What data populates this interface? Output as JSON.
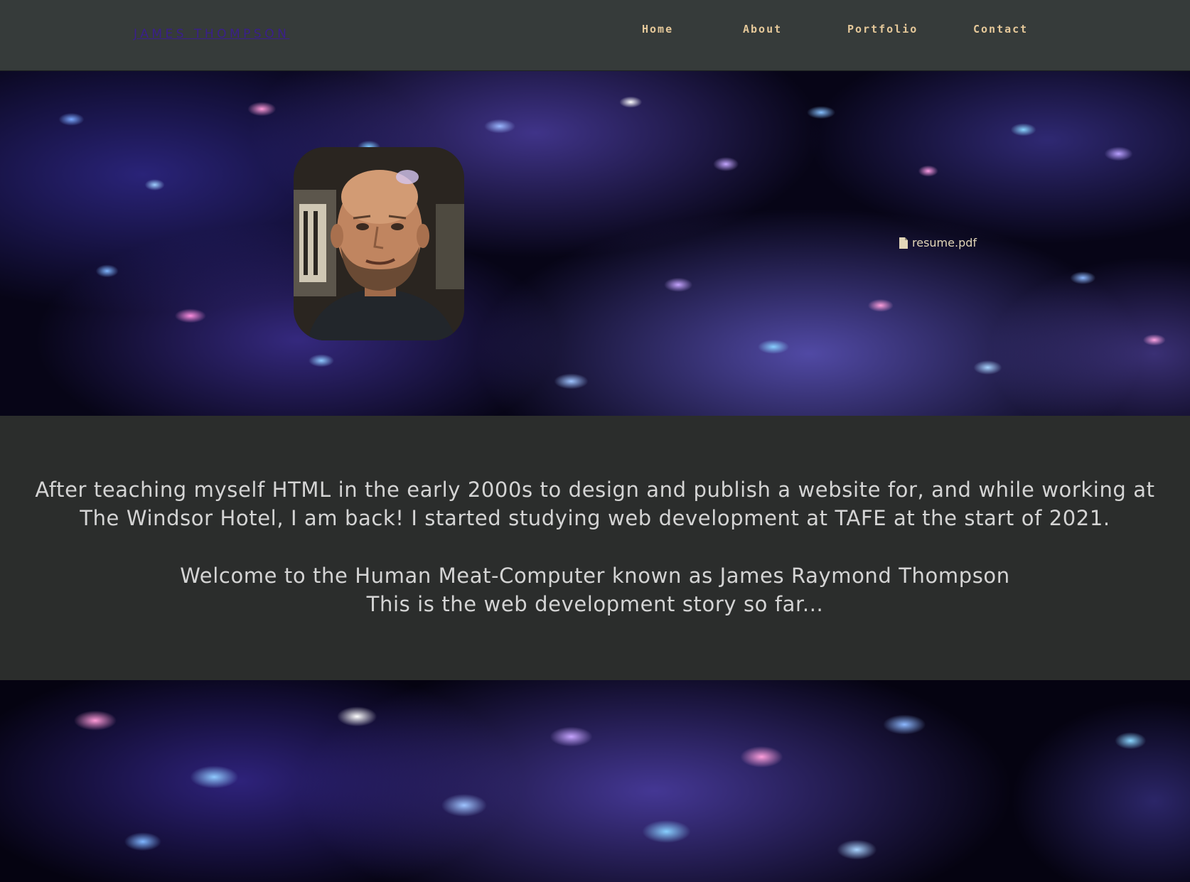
{
  "header": {
    "logo": "JAMES THOMPSON",
    "nav": [
      {
        "label": "Home"
      },
      {
        "label": "About"
      },
      {
        "label": "Portfolio"
      },
      {
        "label": "Contact"
      }
    ]
  },
  "hero": {
    "resume_label": "resume.pdf",
    "resume_icon": "file-icon"
  },
  "intro": {
    "paragraph": "After teaching myself HTML in the early 2000s to design and publish a website for, and while working at The Windsor Hotel, I am back! I started studying web development at TAFE at the start of 2021.",
    "welcome_line1": "Welcome to the Human Meat-Computer known as James Raymond Thompson",
    "welcome_line2": "This is the web development story so far..."
  },
  "colors": {
    "header_bg": "#363b3a",
    "logo": "#3a1f8c",
    "nav_text": "#e6c99a",
    "intro_bg": "#2b2d2c",
    "intro_text": "#d4d4d4"
  }
}
